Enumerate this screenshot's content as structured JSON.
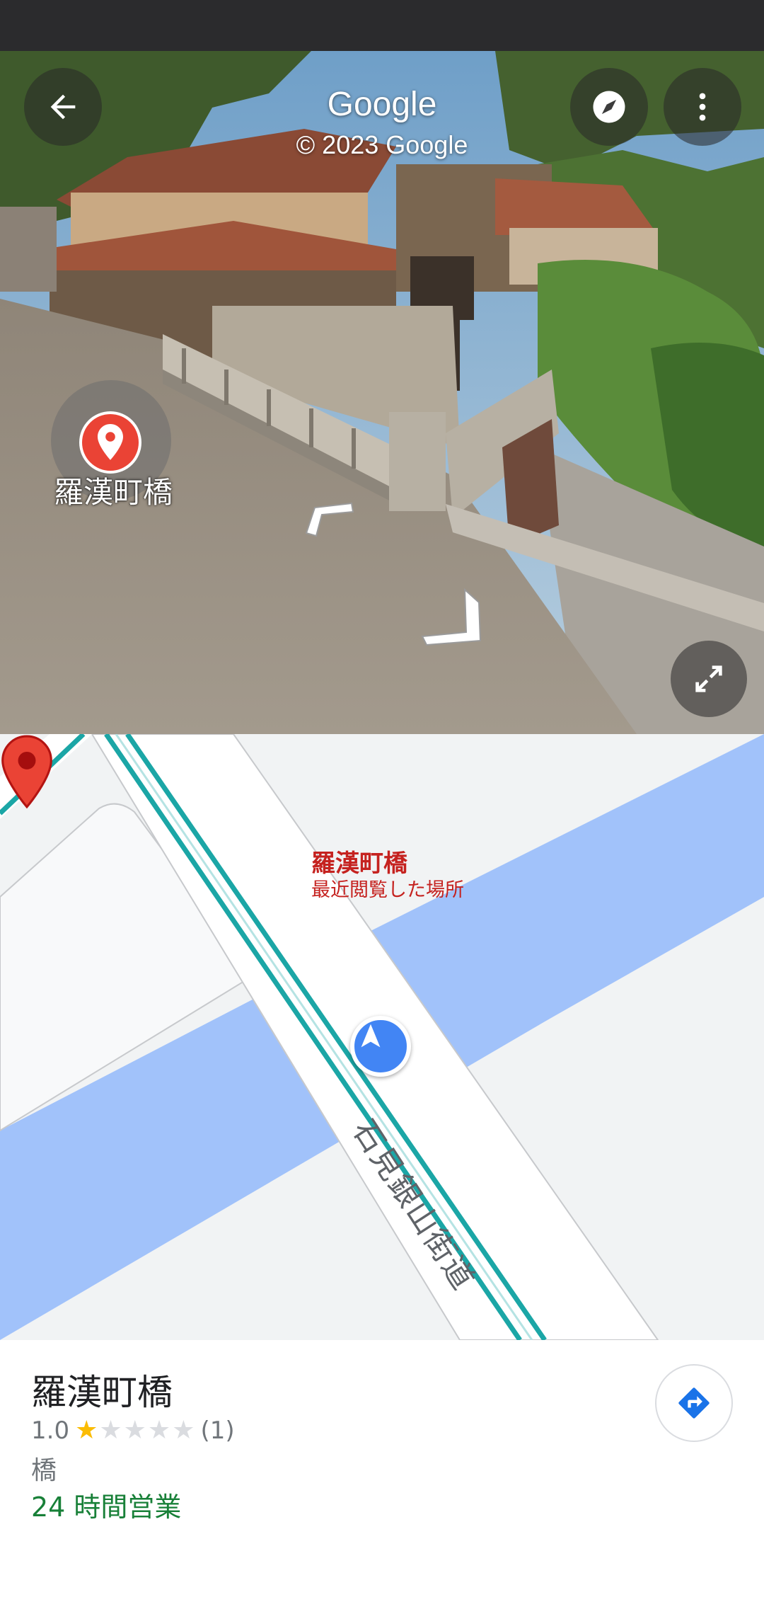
{
  "street_view": {
    "title": "Google",
    "copyright": "© 2023 Google",
    "place_label": "羅漢町橋",
    "icons": [
      "back-arrow-icon",
      "compass-icon",
      "more-vert-icon",
      "fullscreen-icon"
    ]
  },
  "map": {
    "pin_title": "羅漢町橋",
    "pin_subtitle": "最近閲覧した場所",
    "road_name": "石見銀山街道"
  },
  "place": {
    "name": "羅漢町橋",
    "rating": "1.0",
    "stars_filled": 1,
    "stars_total": 5,
    "review_count": "(1)",
    "category": "橋",
    "hours": "24 時間営業"
  },
  "colors": {
    "accent_blue": "#1a73e8",
    "open_green": "#188038",
    "pin_red": "#ea4335",
    "star_gold": "#fbbc04",
    "water_blue": "#a1c2fa",
    "road_teal": "#1ba6a6"
  }
}
